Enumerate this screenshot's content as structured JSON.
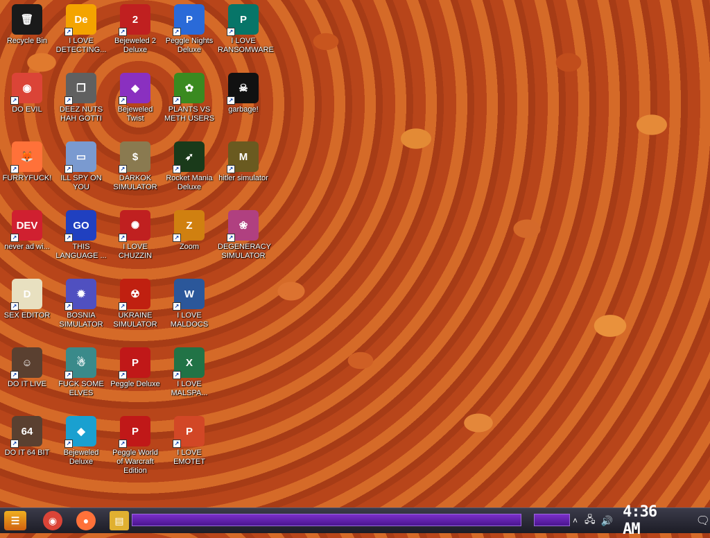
{
  "desktop": {
    "icons": [
      {
        "label": "Recycle Bin",
        "icon": "recycle-bin-icon",
        "bg": "#1a1a1a",
        "glyph": "🗑"
      },
      {
        "label": "I LOVE DETECTING...",
        "icon": "detective-icon",
        "bg": "#f4a400",
        "glyph": "De"
      },
      {
        "label": "Bejeweled 2 Deluxe",
        "icon": "bejeweled-2-icon",
        "bg": "#c02020",
        "glyph": "2"
      },
      {
        "label": "Peggle Nights Deluxe",
        "icon": "peggle-nights-icon",
        "bg": "#2a6ad8",
        "glyph": "P"
      },
      {
        "label": "I LOVE RANSOMWARE",
        "icon": "publisher-icon",
        "bg": "#077568",
        "glyph": "P"
      },
      {
        "label": "DO EVIL",
        "icon": "chrome-icon",
        "bg": "#db4437",
        "glyph": "◉"
      },
      {
        "label": "DEEZ NUTS HAH GOTTI",
        "icon": "windows-stack-icon",
        "bg": "#606060",
        "glyph": "❐"
      },
      {
        "label": "Bejeweled Twist",
        "icon": "bejeweled-twist-icon",
        "bg": "#8a30c0",
        "glyph": "◆"
      },
      {
        "label": "PLANTS VS METH USERS",
        "icon": "plants-vs-zombies-icon",
        "bg": "#3a8a20",
        "glyph": "✿"
      },
      {
        "label": "garbage!",
        "icon": "dragon-logo-icon",
        "bg": "#111111",
        "glyph": "☠"
      },
      {
        "label": "FURRYFUCK!",
        "icon": "firefox-icon",
        "bg": "#ff7139",
        "glyph": "🦊"
      },
      {
        "label": "ILL SPY ON YOU",
        "icon": "remote-desktop-icon",
        "bg": "#7a9ad0",
        "glyph": "▭"
      },
      {
        "label": "DARKOK SIMULATOR",
        "icon": "money-bag-icon",
        "bg": "#8a7a50",
        "glyph": "$"
      },
      {
        "label": "Rocket Mania Deluxe",
        "icon": "rocket-mania-icon",
        "bg": "#1a3a1a",
        "glyph": "➶"
      },
      {
        "label": "hitler simulator",
        "icon": "coin-icon",
        "bg": "#6a5a20",
        "glyph": "M"
      },
      {
        "label": "never ad wi...",
        "icon": "dev-cpp-icon",
        "bg": "#d02030",
        "glyph": "DEV"
      },
      {
        "label": "THIS LANGUAGE ...",
        "icon": "goland-icon",
        "bg": "#2040c0",
        "glyph": "GO"
      },
      {
        "label": "I LOVE CHUZZIN",
        "icon": "chuzzle-icon",
        "bg": "#c02020",
        "glyph": "✺"
      },
      {
        "label": "Zoom",
        "icon": "zuma-icon",
        "bg": "#d08010",
        "glyph": "Z"
      },
      {
        "label": "DEGENERACY SIMULATOR",
        "icon": "flower-logo-icon",
        "bg": "#b04080",
        "glyph": "❀"
      },
      {
        "label": "SEX EDITOR",
        "icon": "editor-icon",
        "bg": "#e8e0c0",
        "glyph": "D"
      },
      {
        "label": "BOSNIA SIMULATOR",
        "icon": "spiked-mine-icon",
        "bg": "#5050c0",
        "glyph": "✹"
      },
      {
        "label": "UKRAINE SIMULATOR",
        "icon": "radiation-icon",
        "bg": "#c02010",
        "glyph": "☢"
      },
      {
        "label": "I LOVE MALDOCS",
        "icon": "word-icon",
        "bg": "#2b579a",
        "glyph": "W"
      },
      {
        "label": "DO IT LIVE",
        "icon": "portrait-icon",
        "bg": "#5a4030",
        "glyph": "☺"
      },
      {
        "label": "FUCK SOME ELVES",
        "icon": "santa-icon",
        "bg": "#3a8a8a",
        "glyph": "☃"
      },
      {
        "label": "Peggle Deluxe",
        "icon": "peggle-icon",
        "bg": "#c01818",
        "glyph": "P"
      },
      {
        "label": "I LOVE MALSPA...",
        "icon": "excel-icon",
        "bg": "#217346",
        "glyph": "X"
      },
      {
        "label": "DO IT 64 BIT",
        "icon": "portrait-64-icon",
        "bg": "#5a4030",
        "glyph": "64"
      },
      {
        "label": "Bejeweled Deluxe",
        "icon": "diamond-icon",
        "bg": "#1aa0d0",
        "glyph": "◆"
      },
      {
        "label": "Peggle World of Warcraft Edition",
        "icon": "peggle-wow-icon",
        "bg": "#c01818",
        "glyph": "P"
      },
      {
        "label": "I LOVE EMOTET",
        "icon": "powerpoint-icon",
        "bg": "#d24726",
        "glyph": "P"
      }
    ]
  },
  "taskbar": {
    "start_label": "☰",
    "pinned": [
      {
        "name": "chrome",
        "icon": "chrome-icon",
        "bg": "#db4437",
        "glyph": "◉"
      },
      {
        "name": "firefox",
        "icon": "firefox-icon",
        "bg": "#ff7139",
        "glyph": "●"
      },
      {
        "name": "file-explorer",
        "icon": "folder-icon",
        "bg": "#e0b030",
        "glyph": "▤"
      }
    ],
    "tray": {
      "chevron": "˄",
      "network": "🖧",
      "volume": "🔊",
      "clock": "4:36 AM",
      "notifications": "🗨"
    }
  }
}
